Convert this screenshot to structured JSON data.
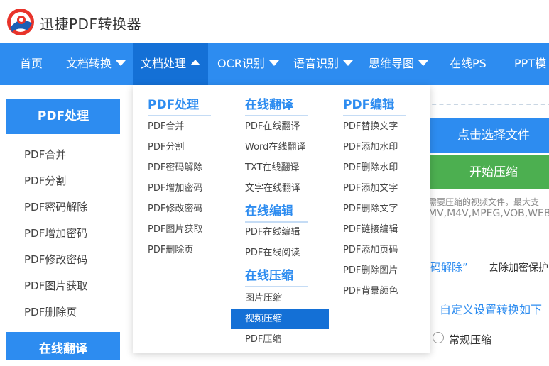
{
  "app": {
    "title": "迅捷PDF转换器"
  },
  "colors": {
    "primary": "#2d8cf0",
    "active": "#1470d6",
    "green": "#4caf50"
  },
  "nav": [
    {
      "label": "首页",
      "caret": ""
    },
    {
      "label": "文档转换",
      "caret": "chevron-down-icon"
    },
    {
      "label": "文档处理",
      "caret": "chevron-up-icon",
      "active": true
    },
    {
      "label": "OCR识别",
      "caret": "chevron-down-icon"
    },
    {
      "label": "语音识别",
      "caret": "chevron-down-icon"
    },
    {
      "label": "思维导图",
      "caret": "chevron-down-icon"
    },
    {
      "label": "在线PS",
      "caret": ""
    },
    {
      "label": "PPT模",
      "caret": ""
    }
  ],
  "sidebar": {
    "heading": "PDF处理",
    "items": [
      "PDF合并",
      "PDF分割",
      "PDF密码解除",
      "PDF增加密码",
      "PDF修改密码",
      "PDF图片获取",
      "PDF删除页"
    ],
    "heading2": "在线翻译"
  },
  "dropdown": {
    "col1": {
      "title": "PDF处理",
      "items": [
        "PDF合并",
        "PDF分割",
        "PDF密码解除",
        "PDF增加密码",
        "PDF修改密码",
        "PDF图片获取",
        "PDF删除页"
      ]
    },
    "col2": {
      "title": "在线翻译",
      "items": [
        "PDF在线翻译",
        "Word在线翻译",
        "TXT在线翻译",
        "文字在线翻译"
      ],
      "title2": "在线编辑",
      "items2": [
        "PDF在线编辑",
        "PDF在线阅读"
      ],
      "title3": "在线压缩",
      "items3": [
        "图片压缩",
        "视频压缩",
        "PDF压缩"
      ]
    },
    "col3": {
      "title": "PDF编辑",
      "items": [
        "PDF替换文字",
        "PDF添加水印",
        "PDF删除水印",
        "PDF添加文字",
        "PDF删除文字",
        "PDF链接编辑",
        "PDF添加页码",
        "PDF删除图片",
        "PDF背景颜色"
      ]
    }
  },
  "content": {
    "select_file": "点击选择文件",
    "start_compress": "开始压缩",
    "hint1": "需要压缩的视频文件，最大支",
    "hint2": "MV,M4V,MPEG,VOB,WEB",
    "pw_link": "码解除”",
    "pw_desc": "去除加密保护",
    "custom_settings": "自定义设置转换如下",
    "radio_label": "常规压缩"
  }
}
